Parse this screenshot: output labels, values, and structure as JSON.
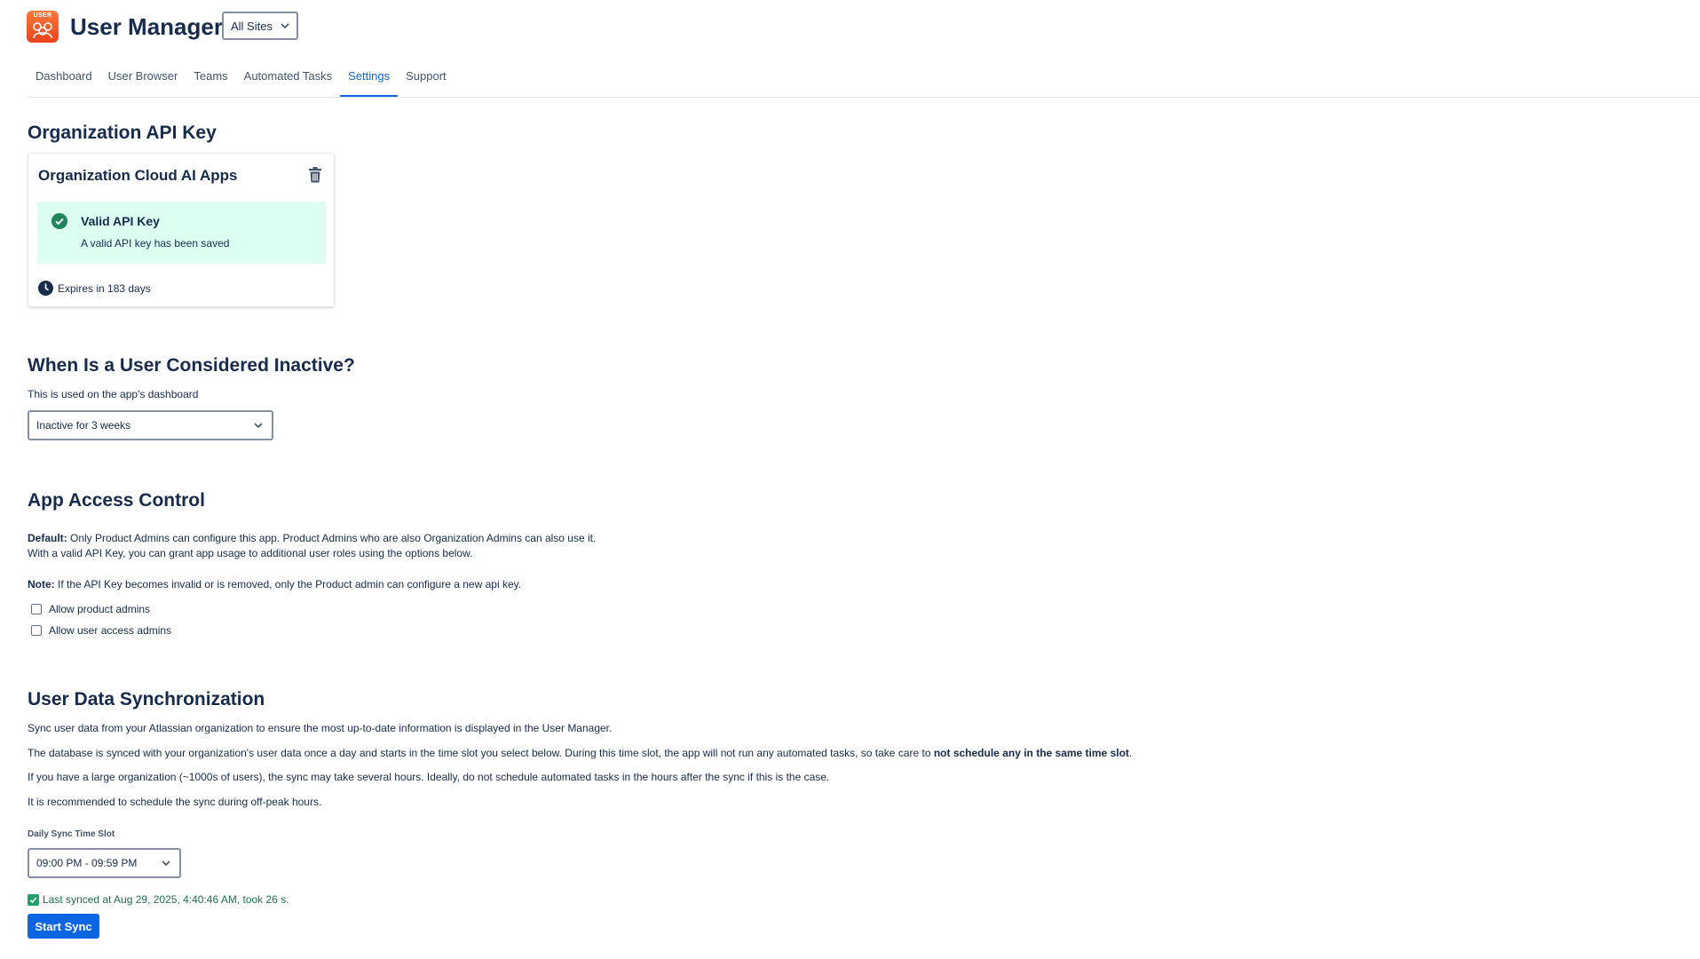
{
  "header": {
    "logo_text": "USER",
    "app_title": "User Manager",
    "site_selector": {
      "value": "All Sites",
      "icon": "chevron-down-icon"
    }
  },
  "nav": {
    "tabs": [
      {
        "label": "Dashboard",
        "active": false
      },
      {
        "label": "User Browser",
        "active": false
      },
      {
        "label": "Teams",
        "active": false
      },
      {
        "label": "Automated Tasks",
        "active": false
      },
      {
        "label": "Settings",
        "active": true
      },
      {
        "label": "Support",
        "active": false
      }
    ],
    "accent_color": "#0c66e4"
  },
  "api_key": {
    "section_title": "Organization API Key",
    "card_title": "Organization Cloud AI Apps",
    "delete_icon": "trash-icon",
    "status": {
      "icon": "check-circle-icon",
      "title": "Valid API Key",
      "message": "A valid API key has been saved",
      "background": "#dcfff1",
      "icon_color": "#1f845a"
    },
    "expiry": {
      "icon": "clock-icon",
      "text": "Expires in 183 days"
    }
  },
  "inactive": {
    "section_title": "When Is a User Considered Inactive?",
    "description": "This is used on the app's dashboard",
    "select_value": "Inactive for 3 weeks"
  },
  "access": {
    "section_title": "App Access Control",
    "default_label": "Default:",
    "default_text": " Only Product Admins can configure this app. Product Admins who are also Organization Admins can also use it.",
    "default_line2": "With a valid API Key, you can grant app usage to additional user roles using the options below.",
    "note_label": "Note:",
    "note_text": " If the API Key becomes invalid or is removed, only the Product admin can configure a new api key.",
    "options": [
      {
        "label": "Allow product admins",
        "checked": false
      },
      {
        "label": "Allow user access admins",
        "checked": false
      }
    ]
  },
  "sync": {
    "section_title": "User Data Synchronization",
    "p1": "Sync user data from your Atlassian organization to ensure the most up-to-date information is displayed in the User Manager.",
    "p2_start": "The database is synced with your organization's user data once a day and starts in the time slot you select below. During this time slot, the app will not run any automated tasks, so take care to ",
    "p2_bold": "not schedule any in the same time slot",
    "p2_end": ".",
    "p3": "If you have a large organization (~1000s of users), the sync may take several hours. Ideally, do not schedule automated tasks in the hours after the sync if this is the case.",
    "p4": "It is recommended to schedule the sync during off-peak hours.",
    "slot_label": "Daily Sync Time Slot",
    "slot_value": "09:00 PM - 09:59 PM",
    "last_synced": "Last synced at Aug 29, 2025, 4:40:46 AM, took 26 s.",
    "status_color": "#216e4e",
    "button_label": "Start Sync"
  }
}
